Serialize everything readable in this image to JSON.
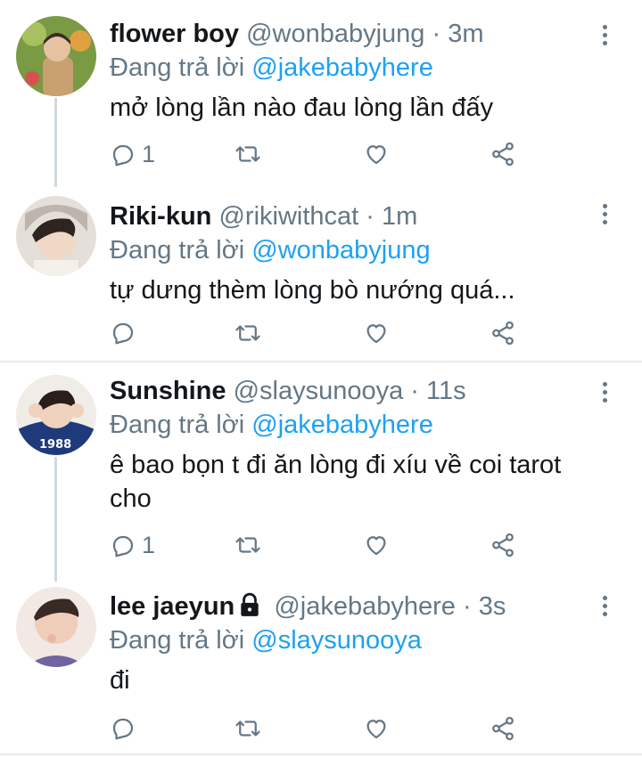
{
  "tweets": [
    {
      "name": "flower boy",
      "handle": "@wonbabyjung",
      "dot": "·",
      "time": "3m",
      "replying_prefix": "Đang trả lời ",
      "replying_to": "@jakebabyhere",
      "text": "mở lòng lần nào đau lòng lần đấy",
      "reply_count": "1",
      "avatar_colors": [
        "#6b8f3a",
        "#c98a5a"
      ]
    },
    {
      "name": "Riki-kun",
      "handle": "@rikiwithcat",
      "dot": "·",
      "time": "1m",
      "replying_prefix": "Đang trả lời ",
      "replying_to": "@wonbabyjung",
      "text": "tự dưng thèm lòng bò nướng quá...",
      "reply_count": "",
      "avatar_colors": [
        "#d9d4cc",
        "#3a2f2a"
      ]
    },
    {
      "name": "Sunshine",
      "handle": "@slaysunooya",
      "dot": "·",
      "time": "11s",
      "replying_prefix": "Đang trả lời ",
      "replying_to": "@jakebabyhere",
      "text": "ê bao bọn t đi ăn lòng đi xíu về coi tarot cho",
      "reply_count": "1",
      "avatar_colors": [
        "#1f3a7a",
        "#e8c9b0"
      ],
      "avatar_text": "1988"
    },
    {
      "name": "lee jaeyun",
      "handle": "@jakebabyhere",
      "dot": "·",
      "time": "3s",
      "replying_prefix": "Đang trả lời ",
      "replying_to": "@slaysunooya",
      "text": "đi",
      "reply_count": "",
      "avatar_colors": [
        "#e8d8d0",
        "#6a5c8a"
      ]
    }
  ],
  "colors": {
    "accent": "#1da1f2",
    "muted": "#657786",
    "thread_line": "#cfd9de"
  },
  "icons": [
    "reply-icon",
    "retweet-icon",
    "like-icon",
    "share-icon",
    "more-icon",
    "lock-icon"
  ]
}
